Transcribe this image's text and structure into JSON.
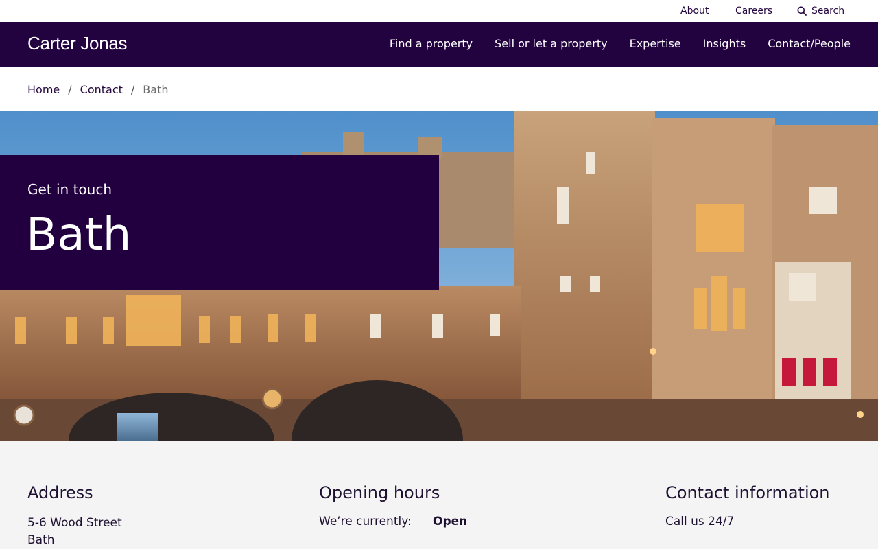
{
  "utility_nav": {
    "about": "About",
    "careers": "Careers",
    "search": "Search",
    "search_icon": "search-icon"
  },
  "brand": {
    "logo_text": "Carter Jonas",
    "primary_color": "#22033f"
  },
  "main_nav": {
    "items": [
      "Find a property",
      "Sell or let a property",
      "Expertise",
      "Insights",
      "Contact/People"
    ]
  },
  "breadcrumb": {
    "home": "Home",
    "contact": "Contact",
    "separator": "/",
    "current": "Bath"
  },
  "hero": {
    "kicker": "Get in touch",
    "title": "Bath"
  },
  "address": {
    "heading": "Address",
    "lines": [
      "5-6 Wood Street",
      "Bath"
    ]
  },
  "opening_hours": {
    "heading": "Opening hours",
    "label": "We’re currently:",
    "status": "Open"
  },
  "contact_info": {
    "heading": "Contact information",
    "call_text": "Call us 24/7"
  }
}
